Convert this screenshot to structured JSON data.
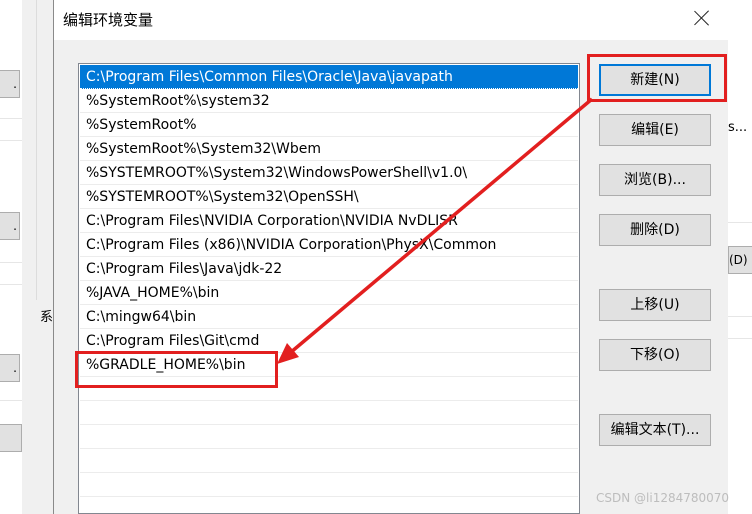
{
  "dialog": {
    "title": "编辑环境变量"
  },
  "list": {
    "items": [
      "C:\\Program Files\\Common Files\\Oracle\\Java\\javapath",
      "%SystemRoot%\\system32",
      "%SystemRoot%",
      "%SystemRoot%\\System32\\Wbem",
      "%SYSTEMROOT%\\System32\\WindowsPowerShell\\v1.0\\",
      "%SYSTEMROOT%\\System32\\OpenSSH\\",
      "C:\\Program Files\\NVIDIA Corporation\\NVIDIA NvDLISR",
      "C:\\Program Files (x86)\\NVIDIA Corporation\\PhysX\\Common",
      "C:\\Program Files\\Java\\jdk-22",
      "%JAVA_HOME%\\bin",
      "C:\\mingw64\\bin",
      "C:\\Program Files\\Git\\cmd",
      "%GRADLE_HOME%\\bin"
    ],
    "selected_index": 0
  },
  "buttons": {
    "new": "新建(N)",
    "edit": "编辑(E)",
    "browse": "浏览(B)...",
    "delete": "删除(D)",
    "move_up": "上移(U)",
    "move_down": "下移(O)",
    "edit_text": "编辑文本(T)..."
  },
  "background": {
    "left_dots": ".",
    "left_label": "系",
    "right_text": "s...",
    "right_button": "(D)"
  },
  "colors": {
    "selection": "#0078d7",
    "annotation": "#e21f1f"
  },
  "watermark": "CSDN @li1284780070"
}
